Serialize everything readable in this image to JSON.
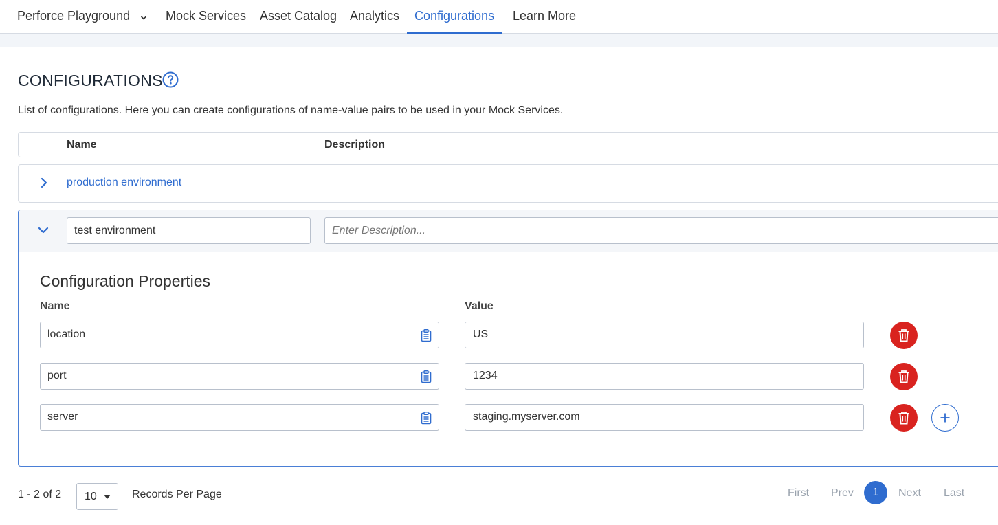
{
  "nav": {
    "items": [
      {
        "label": "Perforce Playground",
        "has_dropdown": true
      },
      {
        "label": "Mock Services"
      },
      {
        "label": "Asset Catalog"
      },
      {
        "label": "Analytics"
      },
      {
        "label": "Configurations",
        "active": true
      },
      {
        "label": "Learn More"
      }
    ]
  },
  "page": {
    "title": "CONFIGURATIONS",
    "help_icon": "question-circle-icon",
    "description": "List of configurations. Here you can create configurations of name-value pairs to be used in your Mock Services."
  },
  "table": {
    "headers": {
      "name": "Name",
      "description": "Description"
    },
    "rows": [
      {
        "name": "production environment",
        "expanded": false
      },
      {
        "name": "test environment",
        "description_placeholder": "Enter Description...",
        "expanded": true,
        "properties_title": "Configuration Properties",
        "property_headers": {
          "name": "Name",
          "value": "Value"
        },
        "properties": [
          {
            "name": "location",
            "value": "US"
          },
          {
            "name": "port",
            "value": "1234"
          },
          {
            "name": "server",
            "value": "staging.myserver.com"
          }
        ]
      }
    ]
  },
  "footer": {
    "count": "1 - 2 of 2",
    "per_page": "10",
    "per_page_label": "Records Per Page",
    "pagination": {
      "first": "First",
      "prev": "Prev",
      "current": "1",
      "next": "Next",
      "last": "Last"
    }
  },
  "colors": {
    "accent": "#2f6ccf",
    "danger": "#d9231f",
    "border": "#d6dbe3"
  }
}
